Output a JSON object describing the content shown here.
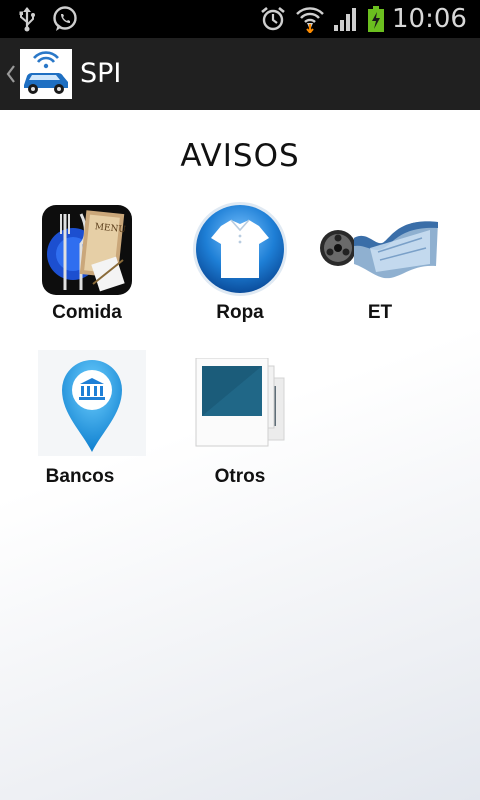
{
  "status_bar": {
    "time": "10:06",
    "icons": [
      "usb-icon",
      "whatsapp-icon",
      "alarm-icon",
      "wifi-icon",
      "signal-icon",
      "battery-charging-icon"
    ]
  },
  "action_bar": {
    "title": "SPI",
    "logo_icon": "car-wifi-logo-icon",
    "up_icon": "chevron-left-icon"
  },
  "section": {
    "title": "AVISOS"
  },
  "tiles": [
    {
      "label": "Comida",
      "icon": "restaurant-menu-icon"
    },
    {
      "label": "Ropa",
      "icon": "tshirt-icon"
    },
    {
      "label": "ET",
      "icon": "film-reel-icon"
    },
    {
      "label": "Bancos",
      "icon": "bank-pin-icon"
    },
    {
      "label": "Otros",
      "icon": "photos-stack-icon"
    }
  ],
  "colors": {
    "status_bar_bg": "#000000",
    "action_bar_bg": "#202020",
    "accent_blue": "#1e7fd6"
  }
}
